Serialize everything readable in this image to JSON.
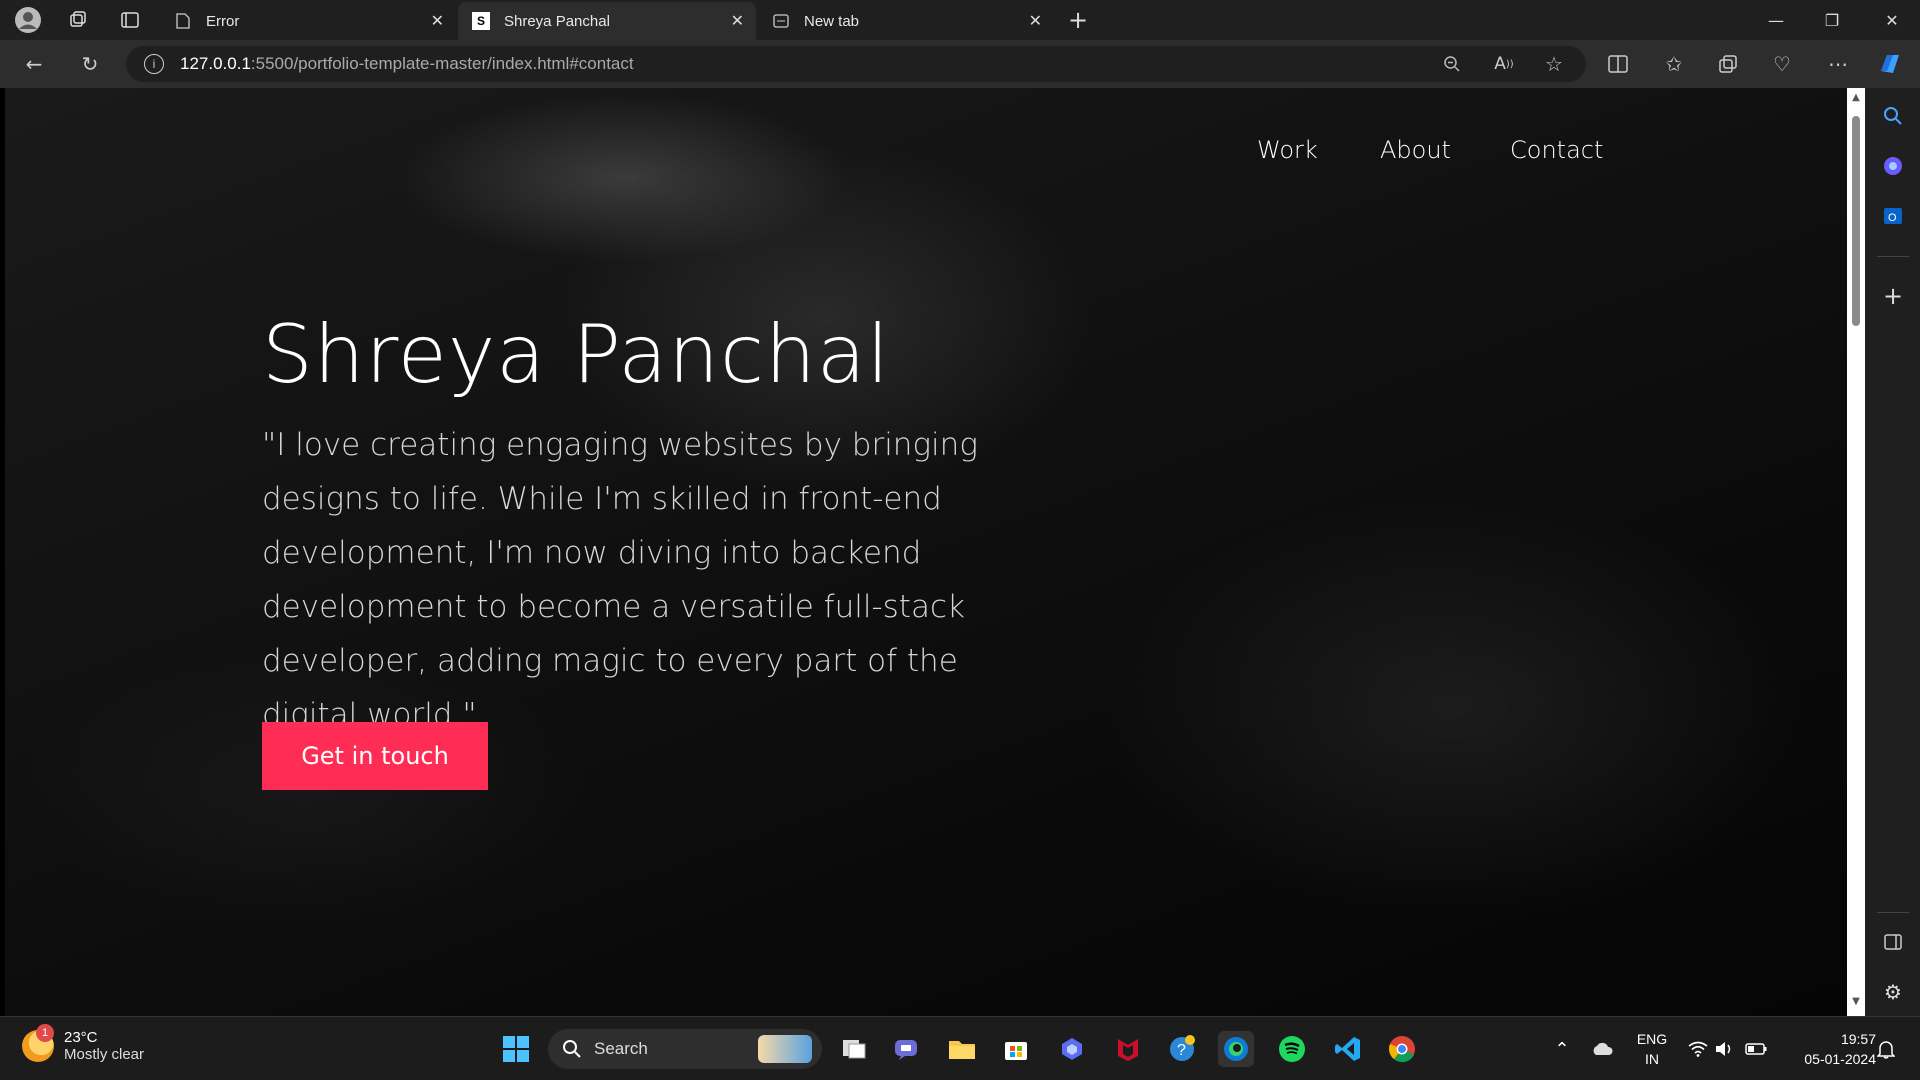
{
  "browser": {
    "tabs": [
      {
        "title": "Error",
        "favicon": "page-icon",
        "active": false
      },
      {
        "title": "Shreya Panchal",
        "favicon": "S",
        "active": true
      },
      {
        "title": "New tab",
        "favicon": "newtab-icon",
        "active": false
      }
    ],
    "url_host": "127.0.0.1",
    "url_rest": ":5500/portfolio-template-master/index.html#contact"
  },
  "page": {
    "nav": [
      "Work",
      "About",
      "Contact"
    ],
    "title": "Shreya Panchal",
    "quote": "\"I love creating engaging websites by bringing designs to life. While I'm skilled in front-end development, I'm now diving into backend development to become a versatile full-stack developer, adding magic to every part of the digital world.\"",
    "cta_label": "Get in touch",
    "accent": "#ff2d55"
  },
  "taskbar": {
    "weather_temp": "23°C",
    "weather_desc": "Mostly clear",
    "weather_badge": "1",
    "search_label": "Search",
    "lang_top": "ENG",
    "lang_bottom": "IN",
    "time": "19:57",
    "date": "05-01-2024"
  }
}
